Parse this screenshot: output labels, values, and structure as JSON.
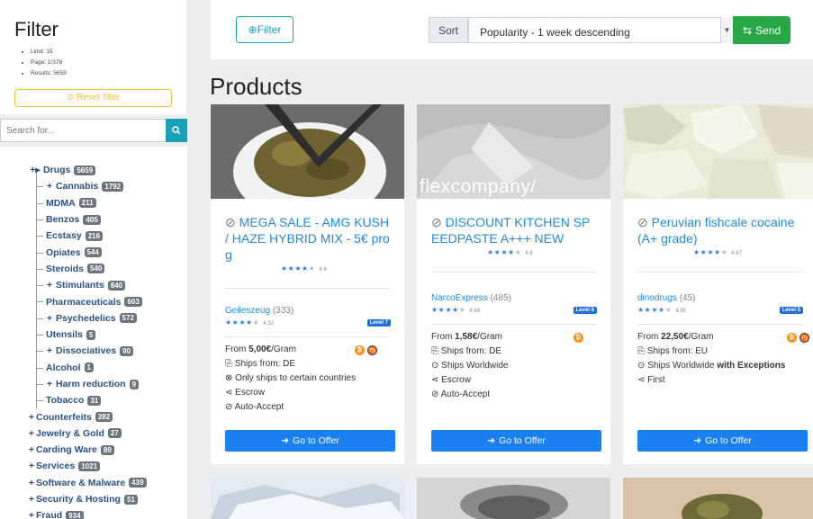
{
  "filter": {
    "title": "Filter",
    "stats": [
      "Limit: 15",
      "Page: 1/378",
      "Results: 5659"
    ],
    "reset_label": "Reset filter"
  },
  "search": {
    "placeholder": "Search for..."
  },
  "categories": [
    {
      "label": "Drugs",
      "count": "5659",
      "expanded": true
    },
    {
      "label": "Cannabis",
      "count": "1792",
      "plus": true
    },
    {
      "label": "MDMA",
      "count": "211"
    },
    {
      "label": "Benzos",
      "count": "405"
    },
    {
      "label": "Ecstasy",
      "count": "216"
    },
    {
      "label": "Opiates",
      "count": "544"
    },
    {
      "label": "Steroids",
      "count": "540"
    },
    {
      "label": "Stimulants",
      "count": "840",
      "plus": true
    },
    {
      "label": "Pharmaceuticals",
      "count": "603"
    },
    {
      "label": "Psychedelics",
      "count": "572",
      "plus": true
    },
    {
      "label": "Utensils",
      "count": "5"
    },
    {
      "label": "Dissociatives",
      "count": "90",
      "plus": true
    },
    {
      "label": "Alcohol",
      "count": "1"
    },
    {
      "label": "Harm reduction",
      "count": "9",
      "plus": true
    },
    {
      "label": "Tobacco",
      "count": "31"
    },
    {
      "label": "Counterfeits",
      "count": "282"
    },
    {
      "label": "Jewelry & Gold",
      "count": "27"
    },
    {
      "label": "Carding Ware",
      "count": "89"
    },
    {
      "label": "Services",
      "count": "1021"
    },
    {
      "label": "Software & Malware",
      "count": "439"
    },
    {
      "label": "Security & Hosting",
      "count": "51"
    },
    {
      "label": "Fraud",
      "count": "934"
    }
  ],
  "toolbar": {
    "filter_label": "Filter",
    "sort_label": "Sort",
    "sort_value": "Popularity - 1 week descending",
    "send_label": "Send"
  },
  "products_title": "Products",
  "products": [
    {
      "title": "MEGA SALE - AMG KUSH / HAZE HYBRID MIX - 5€ pro g",
      "rating": "4.8",
      "rating_stars": 4,
      "vendor": "Geileszeug",
      "vendor_count": "(333)",
      "vendor_rating": "4.52",
      "vendor_stars": 4,
      "level": "Level 7",
      "price_prefix": "From ",
      "price": "5,00€",
      "price_unit": "/Gram",
      "lines": [
        "Ships from: DE",
        "Only ships to certain countries",
        "Escrow",
        "Auto-Accept"
      ],
      "coins": [
        "btc",
        "xmr"
      ],
      "go_label": "Go to Offer"
    },
    {
      "title": "DISCOUNT KITCHEN SPEEDPASTE A+++ NEW",
      "rating": "4.8",
      "rating_stars": 4,
      "vendor": "NarcoExpress",
      "vendor_count": "(485)",
      "vendor_rating": "4.84",
      "vendor_stars": 4,
      "level": "Level 8",
      "price_prefix": "From ",
      "price": "1,58€",
      "price_unit": "/Gram",
      "lines": [
        "Ships from: DE",
        "Ships Worldwide",
        "Escrow",
        "Auto-Accept"
      ],
      "coins": [
        "btc"
      ],
      "go_label": "Go to Offer",
      "image_text": "flexcompany/"
    },
    {
      "title": "Peruvian fishcale cocaine (A+ grade)",
      "rating": "4.87",
      "rating_stars": 4,
      "vendor": "dinodrugs",
      "vendor_count": "(45)",
      "vendor_rating": "4.95",
      "vendor_stars": 4,
      "level": "Level 5",
      "price_prefix": "From ",
      "price": "22,50€",
      "price_unit": "/Gram",
      "lines": [
        "Ships from: EU",
        "Ships Worldwide",
        "First"
      ],
      "ships_suffix": "with Exceptions",
      "coins": [
        "btc",
        "xmr"
      ],
      "go_label": "Go to Offer"
    }
  ],
  "colors": {
    "accent": "#1a7ff0",
    "teal": "#17a2b8",
    "green": "#28a745",
    "gold": "#f0c040",
    "badge": "#6c757d"
  }
}
